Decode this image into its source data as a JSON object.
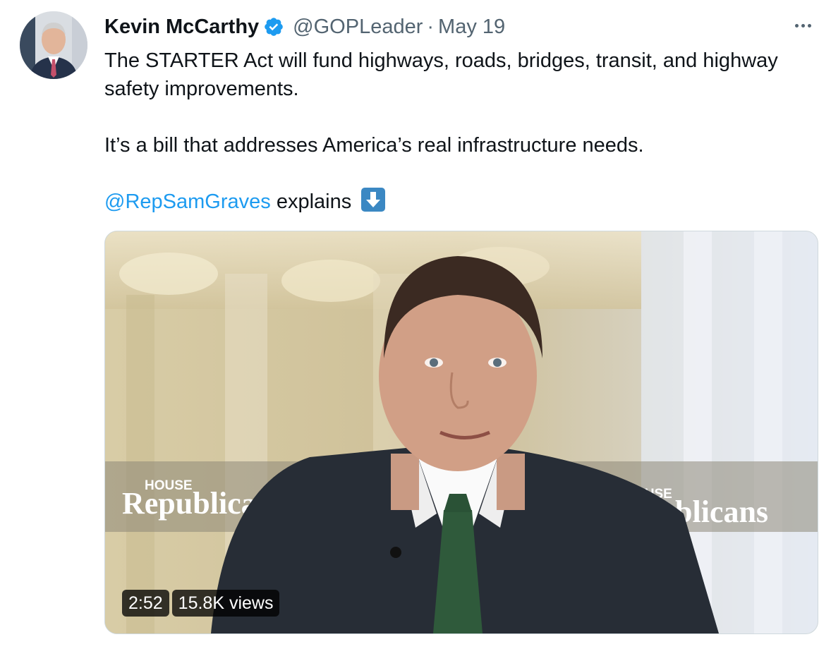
{
  "tweet": {
    "author": {
      "display_name": "Kevin McCarthy",
      "handle": "@GOPLeader",
      "verified_icon": "verified-badge-icon"
    },
    "separator": "·",
    "date": "May 19",
    "more_icon": "more-horizontal-icon",
    "text": {
      "para1": "The STARTER Act will fund highways, roads, bridges, transit, and highway safety improvements.",
      "para2": "It’s a bill that addresses America’s real infrastructure needs.",
      "mention": "@RepSamGraves",
      "explains": "explains",
      "emoji": "down-arrow-emoji"
    },
    "video": {
      "duration": "2:52",
      "views": "15.8K views",
      "overlay_left_small": "HOUSE",
      "overlay_left_big": "Republican",
      "overlay_right_small": "OUSE",
      "overlay_right_big": "blicans"
    }
  },
  "colors": {
    "link": "#1d9bf0",
    "secondary_text": "#536471",
    "verified": "#1d9bf0",
    "emoji_bg": "#3b88c3"
  }
}
